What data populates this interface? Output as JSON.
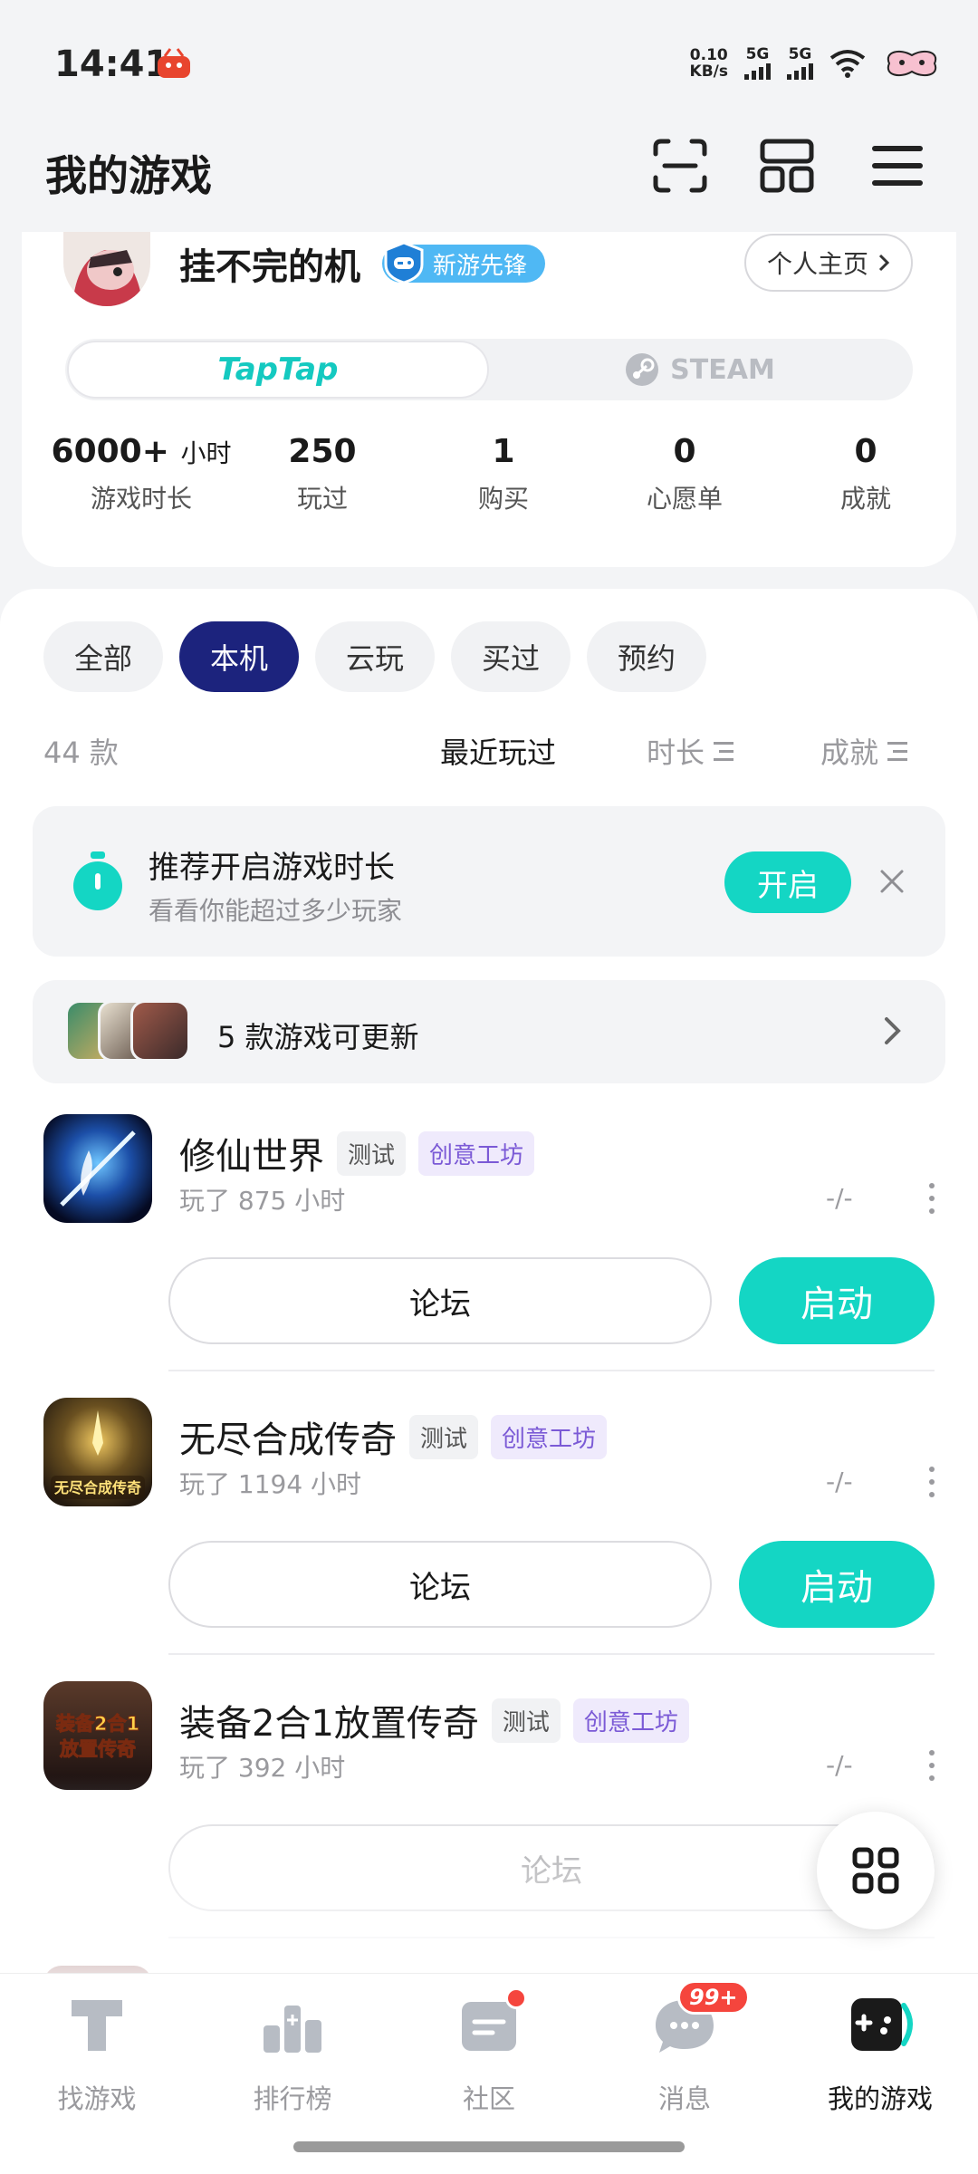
{
  "status_bar": {
    "time": "14:41",
    "net_speed_value": "0.10",
    "net_speed_unit": "KB/s",
    "sim1": "5G",
    "sim2": "5G"
  },
  "header": {
    "title": "我的游戏",
    "icons": [
      "scan-icon",
      "layout-icon",
      "menu-icon"
    ]
  },
  "profile": {
    "username": "挂不完的机",
    "badge": "新游先锋",
    "home_button": "个人主页",
    "platforms": {
      "active": "TapTap",
      "inactive": "STEAM"
    },
    "stats": [
      {
        "value": "6000+",
        "unit": "小时",
        "label": "游戏时长"
      },
      {
        "value": "250",
        "unit": "",
        "label": "玩过"
      },
      {
        "value": "1",
        "unit": "",
        "label": "购买"
      },
      {
        "value": "0",
        "unit": "",
        "label": "心愿单"
      },
      {
        "value": "0",
        "unit": "",
        "label": "成就"
      }
    ]
  },
  "filters": {
    "chips": [
      "全部",
      "本机",
      "云玩",
      "买过",
      "预约"
    ],
    "active_chip": "本机",
    "count": "44 款",
    "sorts": [
      "最近玩过",
      "时长",
      "成就"
    ],
    "active_sort": "最近玩过"
  },
  "recommend": {
    "title": "推荐开启游戏时长",
    "subtitle": "看看你能超过多少玩家",
    "button": "开启"
  },
  "updates": {
    "text": "5 款游戏可更新"
  },
  "games": [
    {
      "name": "修仙世界",
      "tags": [
        "测试",
        "创意工坊"
      ],
      "play_time": "玩了 875 小时",
      "achievement": "-/-",
      "forum": "论坛",
      "launch": "启动"
    },
    {
      "name": "无尽合成传奇",
      "tags": [
        "测试",
        "创意工坊"
      ],
      "play_time": "玩了 1194 小时",
      "achievement": "-/-",
      "forum": "论坛",
      "launch": "启动"
    },
    {
      "name": "装备2合1放置传奇",
      "tags": [
        "测试",
        "创意工坊"
      ],
      "play_time": "玩了 392 小时",
      "achievement": "-/-",
      "forum": "论坛",
      "launch": ""
    }
  ],
  "game_icon_texts": {
    "g2": "无尽合成传奇",
    "g3_line1": "装备2合1",
    "g3_line2": "放置传奇"
  },
  "bottom_nav": {
    "items": [
      "找游戏",
      "排行榜",
      "社区",
      "消息",
      "我的游戏"
    ],
    "active": "我的游戏",
    "message_badge": "99+"
  },
  "colors": {
    "accent": "#14d6c4",
    "chip_active": "#1c237d",
    "badge_blue": "#4fb8f4",
    "workshop_tag": "#7b5ad6",
    "notification_red": "#f5453d"
  }
}
